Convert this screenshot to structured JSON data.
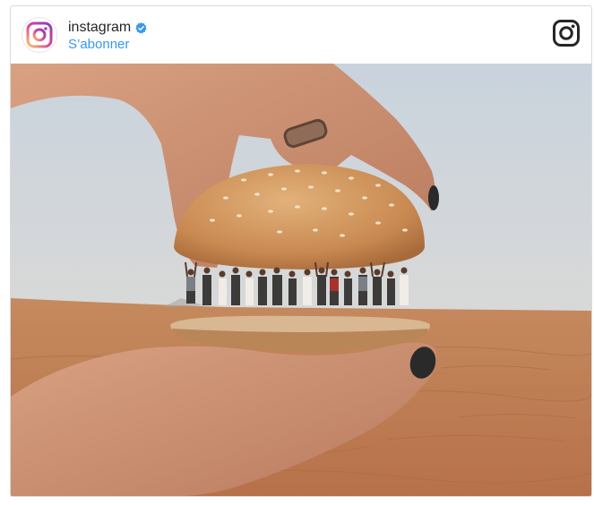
{
  "post": {
    "account_name": "instagram",
    "verified": true,
    "follow_label": "S’abonner"
  },
  "icons": {
    "avatar": "instagram-logo-icon",
    "verified": "verified-badge-icon",
    "header_right": "instagram-glyph-icon"
  },
  "colors": {
    "link": "#3897f0",
    "text": "#262626",
    "border": "#dbdbdb",
    "sand": "#c8855a",
    "sky": "#d8dce0"
  }
}
